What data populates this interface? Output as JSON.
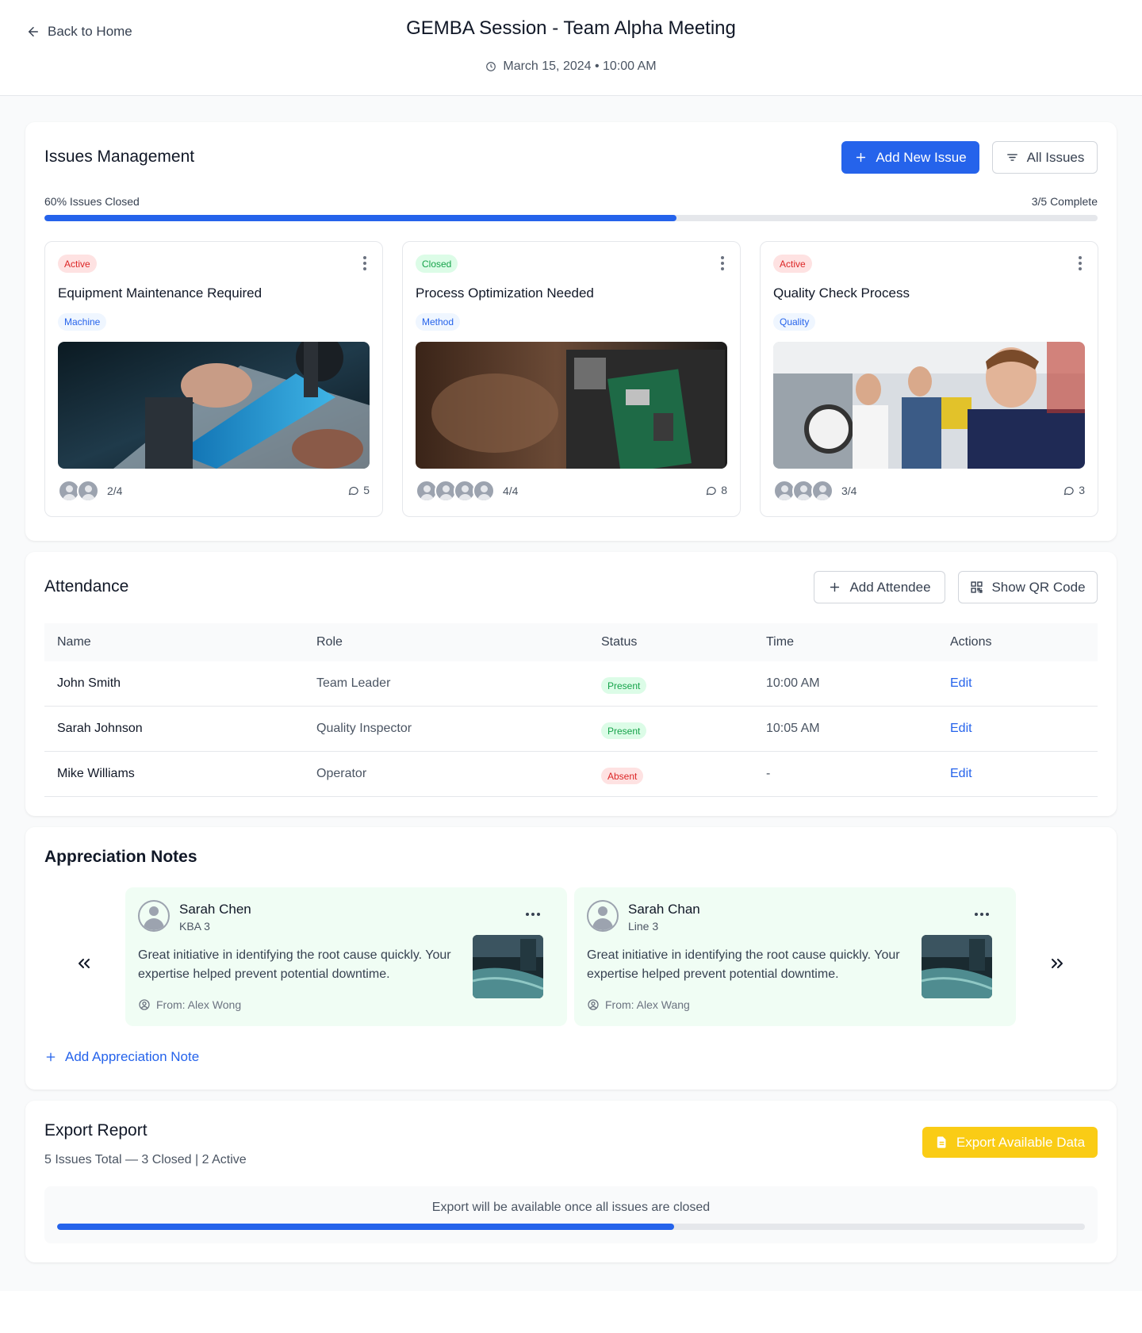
{
  "header": {
    "back_label": "Back to Home",
    "title": "GEMBA Session - Team Alpha Meeting",
    "datetime": "March 15, 2024 • 10:00 AM"
  },
  "issues": {
    "title": "Issues Management",
    "add_button": "Add New Issue",
    "filter_button": "All Issues",
    "progress_label": "60% Issues Closed",
    "progress_fraction": 0.6,
    "complete_label": "3/5 Complete",
    "cards": [
      {
        "status": "Active",
        "title": "Equipment Maintenance Required",
        "category": "Machine",
        "attendance": "2/4",
        "comments": "5"
      },
      {
        "status": "Closed",
        "title": "Process Optimization Needed",
        "category": "Method",
        "attendance": "4/4",
        "comments": "8"
      },
      {
        "status": "Active",
        "title": "Quality Check Process",
        "category": "Quality",
        "attendance": "3/4",
        "comments": "3"
      }
    ]
  },
  "attendance": {
    "title": "Attendance",
    "add_button": "Add Attendee",
    "qr_button": "Show QR Code",
    "columns": [
      "Name",
      "Role",
      "Status",
      "Time",
      "Actions"
    ],
    "rows": [
      {
        "name": "John Smith",
        "role": "Team Leader",
        "status": "Present",
        "time": "10:00 AM",
        "action": "Edit"
      },
      {
        "name": "Sarah Johnson",
        "role": "Quality Inspector",
        "status": "Present",
        "time": "10:05 AM",
        "action": "Edit"
      },
      {
        "name": "Mike Williams",
        "role": "Operator",
        "status": "Absent",
        "time": "-",
        "action": "Edit"
      }
    ]
  },
  "appreciation": {
    "title": "Appreciation Notes",
    "notes": [
      {
        "name": "Sarah Chen",
        "role": "KBA 3",
        "text": "Great initiative in identifying the root cause quickly. Your expertise helped prevent potential downtime.",
        "from": "From: Alex Wong"
      },
      {
        "name": "Sarah Chan",
        "role": "Line 3",
        "text": "Great initiative in identifying the root cause quickly. Your expertise helped prevent potential downtime.",
        "from": "From: Alex Wang"
      }
    ],
    "add_label": "Add Appreciation Note"
  },
  "export": {
    "title": "Export Report",
    "summary": "5 Issues Total — 3 Closed | 2 Active",
    "button": "Export Available Data",
    "note": "Export will be available once all issues are closed",
    "progress_fraction": 0.6
  },
  "colors": {
    "accent": "#2563eb",
    "export_button": "#facc15",
    "active_badge": "#dc2626",
    "closed_badge": "#16a34a",
    "note_bg": "#f0fdf4"
  }
}
